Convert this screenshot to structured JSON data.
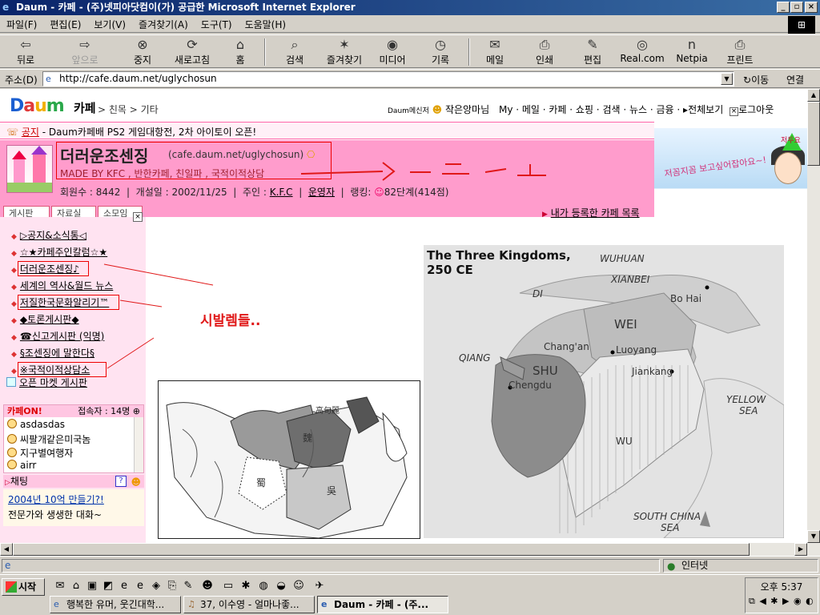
{
  "window": {
    "title": "Daum - 카페 - (주)넷피아닷컴이(가) 공급한 Microsoft Internet Explorer",
    "min": "_",
    "max": "▫",
    "close": "×"
  },
  "menu": [
    "파일(F)",
    "편집(E)",
    "보기(V)",
    "즐겨찾기(A)",
    "도구(T)",
    "도움말(H)"
  ],
  "toolbar": {
    "back": "뒤로",
    "forward": "앞으로",
    "stop": "중지",
    "refresh": "새로고침",
    "home": "홈",
    "search": "검색",
    "favorites": "즐겨찾기",
    "media": "미디어",
    "history": "기록",
    "mail": "메일",
    "print": "인쇄",
    "edit": "편집",
    "real": "Real.com",
    "netpia": "Netpia",
    "printer": "프린트"
  },
  "address": {
    "label": "주소(D)",
    "url": "http://cafe.daum.net/uglychosun",
    "go": "이동",
    "links": "연결"
  },
  "daum": {
    "logo": [
      "D",
      "a",
      "u",
      "m"
    ],
    "cafe": "카페",
    "breadcrumb": "> 친목 > 기타",
    "topnav": {
      "messenger": "Daum메신저",
      "user": "작은앙마님",
      "links": "My · 메일 · 카페 · 쇼핑 · 검색 · 뉴스 · 금융",
      "all": "전체보기",
      "logout": "로그아웃"
    },
    "notice": {
      "label": "공지",
      "text": "- Daum카페배 PS2 게임대항전, 2차 아이토이 오픈!"
    },
    "cafe_name": "더러운조센징",
    "cafe_url": "(cafe.daum.net/uglychosun)",
    "cafe_desc": "MADE BY KFC , 반한카페, 친일파 , 국적이적상담",
    "cafe_info": {
      "members_label": "회원수 : ",
      "members": "8442",
      "opened_label": "개설일 : ",
      "opened": "2002/11/25",
      "owner_label": "주인 : ",
      "owner": "K.F.C",
      "staff": "운영자",
      "rank_label": "랭킹: ",
      "rank": "82단계(414점)"
    },
    "banner_text": "저꼼지꼼 보고싶어잡아요~!",
    "banner_sign": "저두요",
    "tabs": [
      "게시판",
      "자료실",
      "소모임"
    ],
    "my_registered": "내가 등록한 카페 목록",
    "sidebar_menu": [
      "▷공지&소식통◁",
      "☆★카페주인칼럼☆★",
      "더러운조센징♪",
      "세계의 역사&월드 뉴스",
      "저질한국문화알리기™",
      "◆토론게시판◆",
      "☎신고게시판 (익명)",
      "§조센징에 말한다§",
      "※국적이적상담소"
    ],
    "open_market": "오픈 마켓 게시판",
    "online": {
      "logo": "카페ON!",
      "count_label": "접속자 : ",
      "count": "14명",
      "users": [
        "asdasdas",
        "씨팔개같은미국놈",
        "지구별여행자",
        "airr"
      ]
    },
    "chat": {
      "label": "채팅",
      "help": "?"
    },
    "promo": {
      "link": "2004년 10억 만들기?!",
      "text": "전문가와 생생한 대화~"
    },
    "scribble": "▷ ㅡ ㅡ ㅡ ㅗ",
    "annotation": "시발렘들.."
  },
  "map_right": {
    "title": "The Three Kingdoms,",
    "year": "250 CE",
    "labels": {
      "wuhuan": "WUHUAN",
      "xianbei": "XIANBEI",
      "di": "DI",
      "bohai": "Bo Hai",
      "wei": "WEI",
      "changan": "Chang'an",
      "luoyang": "Luoyang",
      "qiang": "QIANG",
      "shu": "SHU",
      "jiankang": "Jiankang",
      "chengdu": "Chengdu",
      "yellow": "YELLOW",
      "sea": "SEA",
      "wu": "WU",
      "south": "SOUTH CHINA",
      "sea2": "SEA"
    }
  },
  "map_left": {
    "labels": [
      "高句麗",
      "魏",
      "蜀",
      "吳"
    ]
  },
  "status": {
    "zone": "인터넷"
  },
  "taskbar": {
    "start": "시작",
    "clock": "오후 5:37",
    "tasks": [
      "행복한 유머, 웃긴대학...",
      "37, 이수영 - 얼마나좋...",
      "Daum - 카페 - (주..."
    ]
  },
  "colors": {
    "pink": "#ff9ccc",
    "titlebar": "#0a246a",
    "red": "#e01818"
  }
}
